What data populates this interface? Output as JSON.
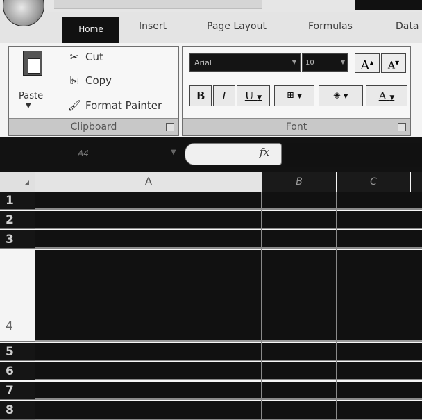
{
  "ribbon_tabs": [
    "Home",
    "Insert",
    "Page Layout",
    "Formulas",
    "Data"
  ],
  "clipboard": {
    "paste_label": "Paste",
    "cut_label": "Cut",
    "copy_label": "Copy",
    "format_painter_label": "Format Painter",
    "group_label": "Clipboard"
  },
  "font": {
    "font_name": "Arial",
    "font_size": "10",
    "group_label": "Font",
    "grow_label": "A",
    "shrink_label": "A",
    "bold_label": "B",
    "italic_label": "I",
    "underline_label": "U",
    "font_color_label": "A"
  },
  "formula_bar": {
    "name_box": "A4",
    "fx_label": "fx",
    "formula": ""
  },
  "grid": {
    "columns": [
      "A",
      "B",
      "C"
    ],
    "rows": [
      "1",
      "2",
      "3",
      "4",
      "5",
      "6",
      "7",
      "8"
    ],
    "selected_row": "4"
  },
  "icons": {
    "office_button": "office-logo-icon",
    "paste": "clipboard-paste-icon",
    "cut": "scissors-icon",
    "copy": "copy-icon",
    "format_painter": "paintbrush-icon",
    "borders": "borders-icon",
    "fill": "fill-color-icon"
  }
}
